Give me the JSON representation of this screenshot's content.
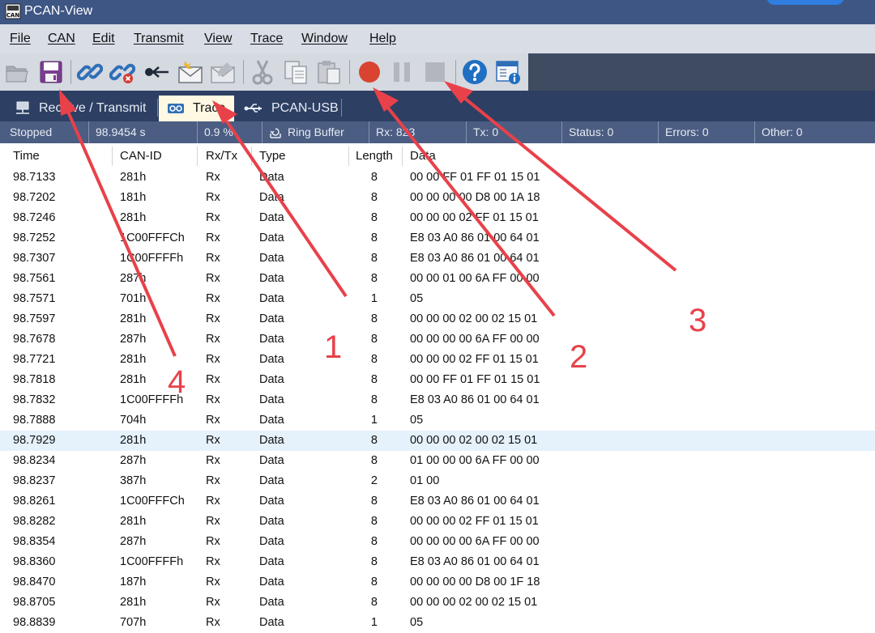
{
  "window": {
    "title": "PCAN-View",
    "app_icon_label": "CAN"
  },
  "menu": [
    "File",
    "CAN",
    "Edit",
    "Transmit",
    "View",
    "Trace",
    "Window",
    "Help"
  ],
  "toolbar": {
    "buttons": [
      {
        "name": "open-icon"
      },
      {
        "name": "save-icon"
      },
      {
        "name": "connect-icon"
      },
      {
        "name": "disconnect-icon"
      },
      {
        "name": "reset-icon"
      },
      {
        "name": "new-message-icon"
      },
      {
        "name": "edit-message-icon"
      },
      {
        "name": "cut-icon"
      },
      {
        "name": "copy-icon"
      },
      {
        "name": "paste-icon"
      },
      {
        "name": "record-icon"
      },
      {
        "name": "pause-icon"
      },
      {
        "name": "stop-icon"
      },
      {
        "name": "help-icon"
      },
      {
        "name": "info-icon"
      }
    ]
  },
  "tabs": [
    {
      "label": "Receive / Transmit",
      "active": false
    },
    {
      "label": "Trace",
      "active": true
    },
    {
      "label": "PCAN-USB",
      "active": false
    }
  ],
  "status": {
    "state": "Stopped",
    "time": "98.9454 s",
    "fill": "0.9 %",
    "mode": "Ring Buffer",
    "rx": "Rx: 823",
    "tx": "Tx: 0",
    "status": "Status: 0",
    "errors": "Errors: 0",
    "other": "Other: 0"
  },
  "columns": [
    "Time",
    "CAN-ID",
    "Rx/Tx",
    "Type",
    "Length",
    "Data"
  ],
  "rows": [
    [
      "98.7133",
      "281h",
      "Rx",
      "Data",
      "8",
      "00 00 FF 01 FF 01 15 01"
    ],
    [
      "98.7202",
      "181h",
      "Rx",
      "Data",
      "8",
      "00 00 00 00 D8 00 1A 18"
    ],
    [
      "98.7246",
      "281h",
      "Rx",
      "Data",
      "8",
      "00 00 00 02 FF 01 15 01"
    ],
    [
      "98.7252",
      "1C00FFFCh",
      "Rx",
      "Data",
      "8",
      "E8 03 A0 86 01 00 64 01"
    ],
    [
      "98.7307",
      "1C00FFFFh",
      "Rx",
      "Data",
      "8",
      "E8 03 A0 86 01 00 64 01"
    ],
    [
      "98.7561",
      "287h",
      "Rx",
      "Data",
      "8",
      "00 00 01 00 6A FF 00 00"
    ],
    [
      "98.7571",
      "701h",
      "Rx",
      "Data",
      "1",
      "05"
    ],
    [
      "98.7597",
      "281h",
      "Rx",
      "Data",
      "8",
      "00 00 00 02 00 02 15 01"
    ],
    [
      "98.7678",
      "287h",
      "Rx",
      "Data",
      "8",
      "00 00 00 00 6A FF 00 00"
    ],
    [
      "98.7721",
      "281h",
      "Rx",
      "Data",
      "8",
      "00 00 00 02 FF 01 15 01"
    ],
    [
      "98.7818",
      "281h",
      "Rx",
      "Data",
      "8",
      "00 00 FF 01 FF 01 15 01"
    ],
    [
      "98.7832",
      "1C00FFFFh",
      "Rx",
      "Data",
      "8",
      "E8 03 A0 86 01 00 64 01"
    ],
    [
      "98.7888",
      "704h",
      "Rx",
      "Data",
      "1",
      "05"
    ],
    [
      "98.7929",
      "281h",
      "Rx",
      "Data",
      "8",
      "00 00 00 02 00 02 15 01"
    ],
    [
      "98.8234",
      "287h",
      "Rx",
      "Data",
      "8",
      "01 00 00 00 6A FF 00 00"
    ],
    [
      "98.8237",
      "387h",
      "Rx",
      "Data",
      "2",
      "01 00"
    ],
    [
      "98.8261",
      "1C00FFFCh",
      "Rx",
      "Data",
      "8",
      "E8 03 A0 86 01 00 64 01"
    ],
    [
      "98.8282",
      "281h",
      "Rx",
      "Data",
      "8",
      "00 00 00 02 FF 01 15 01"
    ],
    [
      "98.8354",
      "287h",
      "Rx",
      "Data",
      "8",
      "00 00 00 00 6A FF 00 00"
    ],
    [
      "98.8360",
      "1C00FFFFh",
      "Rx",
      "Data",
      "8",
      "E8 03 A0 86 01 00 64 01"
    ],
    [
      "98.8470",
      "187h",
      "Rx",
      "Data",
      "8",
      "00 00 00 00 D8 00 1F 18"
    ],
    [
      "98.8705",
      "281h",
      "Rx",
      "Data",
      "8",
      "00 00 00 02 00 02 15 01"
    ],
    [
      "98.8839",
      "707h",
      "Rx",
      "Data",
      "1",
      "05"
    ]
  ],
  "selected_row_index": 13,
  "annotations": [
    "1",
    "2",
    "3",
    "4"
  ],
  "colors": {
    "arrow": "#e8414a",
    "record": "#d94430",
    "selected_row": "#e5f1fb"
  }
}
